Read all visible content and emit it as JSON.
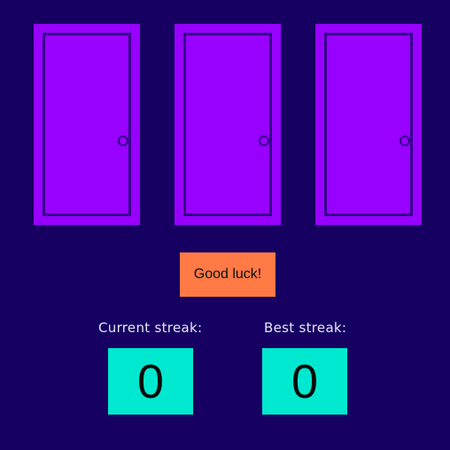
{
  "doors": [
    {
      "id": 1
    },
    {
      "id": 2
    },
    {
      "id": 3
    }
  ],
  "button": {
    "label": "Good luck!"
  },
  "streaks": {
    "current_label": "Current streak:",
    "current_value": "0",
    "best_label": "Best streak:",
    "best_value": "0"
  },
  "colors": {
    "background": "#160061",
    "door": "#9800ff",
    "door_outline": "#35018a",
    "button": "#ff7a45",
    "streak_box": "#00e8cf"
  }
}
